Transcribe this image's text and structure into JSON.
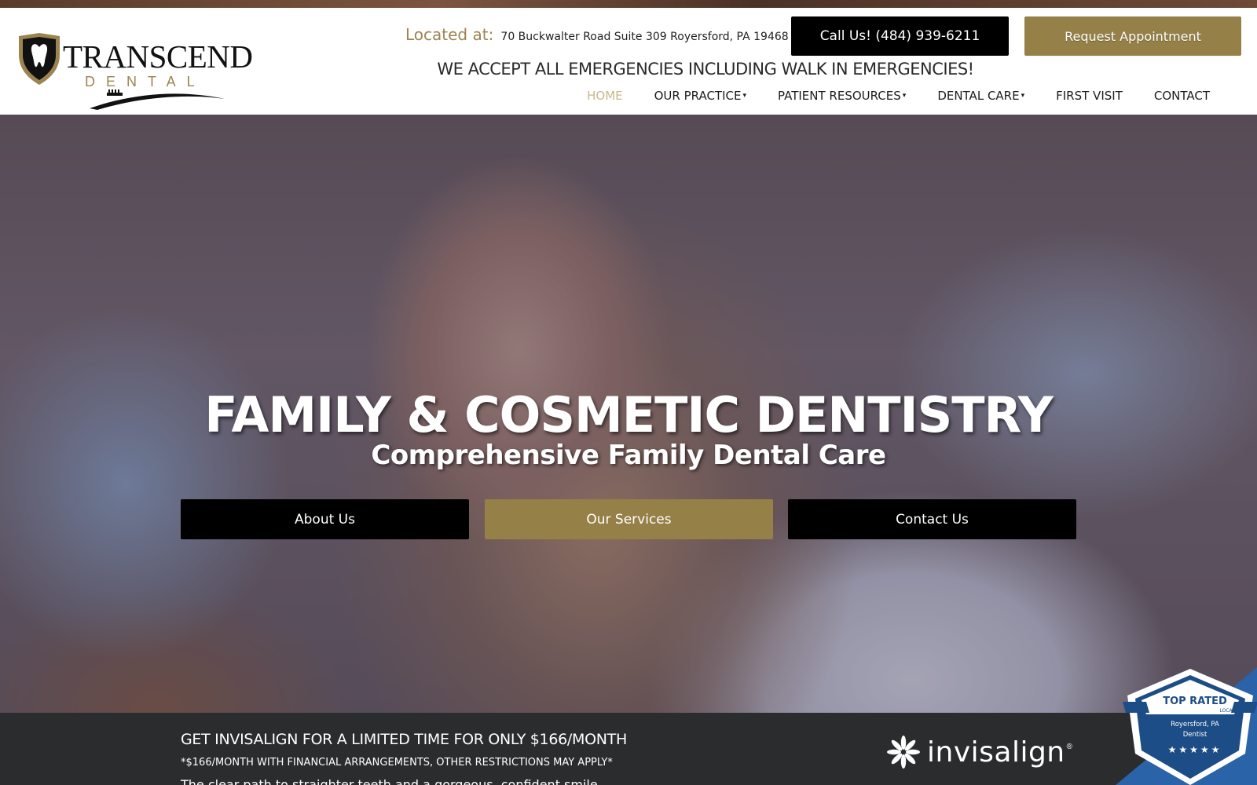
{
  "brand": {
    "logo_word": "TRANSCEND",
    "logo_sub": "DENTAL",
    "accent_color": "#958048"
  },
  "header": {
    "location_label": "Located at:",
    "location_address": "70 Buckwalter Road Suite 309 Royersford, PA 19468",
    "call_button": "Call Us! (484) 939-6211",
    "appointment_button": "Request Appointment",
    "emergency_text": "WE ACCEPT ALL EMERGENCIES INCLUDING WALK IN EMERGENCIES!"
  },
  "nav": {
    "items": [
      {
        "label": "HOME",
        "active": true,
        "dropdown": false
      },
      {
        "label": "OUR PRACTICE",
        "active": false,
        "dropdown": true
      },
      {
        "label": "PATIENT RESOURCES",
        "active": false,
        "dropdown": true
      },
      {
        "label": "DENTAL CARE",
        "active": false,
        "dropdown": true
      },
      {
        "label": "FIRST VISIT",
        "active": false,
        "dropdown": false
      },
      {
        "label": "CONTACT",
        "active": false,
        "dropdown": false
      }
    ],
    "caret": "▾"
  },
  "hero": {
    "title": "FAMILY & COSMETIC DENTISTRY",
    "subtitle": "Comprehensive Family Dental Care",
    "buttons": [
      "About Us",
      "Our Services",
      "Contact Us"
    ]
  },
  "promo": {
    "title": "GET INVISALIGN FOR A LIMITED TIME FOR ONLY $166/MONTH",
    "note": "*$166/MONTH WITH FINANCIAL ARRANGEMENTS, OTHER RESTRICTIONS MAY APPLY*",
    "cut_text": "The clear path to straighter teeth and a gorgeous, confident smile.",
    "brand_logo": "invisalign",
    "brand_reg": "®"
  },
  "badge": {
    "title": "TOP RATED",
    "subtitle": "LOCAL",
    "location": "Royersford, PA",
    "category": "Dentist",
    "stars": "★★★★★"
  }
}
